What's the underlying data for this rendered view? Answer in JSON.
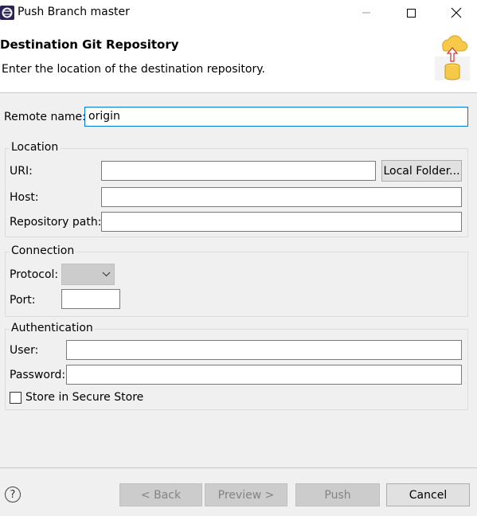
{
  "window": {
    "title": "Push Branch master"
  },
  "header": {
    "title": "Destination Git Repository",
    "description": "Enter the location of the destination repository."
  },
  "remote": {
    "label": "Remote name:",
    "value": "origin"
  },
  "location": {
    "legend": "Location",
    "uri_label": "URI:",
    "uri_value": "",
    "local_folder_button": "Local Folder...",
    "host_label": "Host:",
    "host_value": "",
    "repo_path_label": "Repository path:",
    "repo_path_value": ""
  },
  "connection": {
    "legend": "Connection",
    "protocol_label": "Protocol:",
    "protocol_value": "",
    "port_label": "Port:",
    "port_value": ""
  },
  "authentication": {
    "legend": "Authentication",
    "user_label": "User:",
    "user_value": "",
    "password_label": "Password:",
    "password_value": "",
    "store_label": "Store in Secure Store",
    "store_checked": false
  },
  "footer": {
    "help_icon": "?",
    "back": "< Back",
    "preview": "Preview >",
    "push": "Push",
    "cancel": "Cancel"
  },
  "colors": {
    "focus_border": "#0078d7",
    "background": "#f0f0f0"
  }
}
